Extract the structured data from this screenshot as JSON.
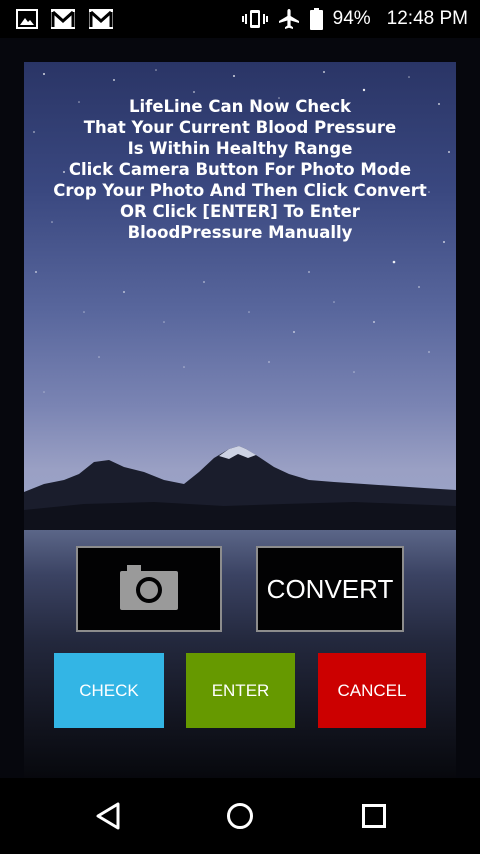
{
  "status_bar": {
    "left_icons": [
      "image-icon",
      "gmail-icon",
      "gmail-icon"
    ],
    "right_icons": [
      "vibrate-icon",
      "airplane-mode-icon",
      "battery-icon"
    ],
    "battery_percent": "94%",
    "time": "12:48 PM"
  },
  "instructions": {
    "lines": [
      "LifeLine Can Now Check",
      "That Your Current Blood Pressure",
      "Is Within Healthy Range",
      "Click Camera Button For Photo Mode",
      "Crop Your Photo And Then Click Convert",
      "OR Click [ENTER] To Enter",
      "BloodPressure Manually"
    ]
  },
  "camera_button": {
    "icon": "camera-icon"
  },
  "convert_button": {
    "label": "CONVERT"
  },
  "actions": {
    "check": {
      "label": "CHECK",
      "color": "#33b5e5"
    },
    "enter": {
      "label": "ENTER",
      "color": "#669900"
    },
    "cancel": {
      "label": "CANCEL",
      "color": "#cc0000"
    }
  },
  "nav_bar": {
    "icons": [
      "back-icon",
      "home-icon",
      "recents-icon"
    ]
  }
}
